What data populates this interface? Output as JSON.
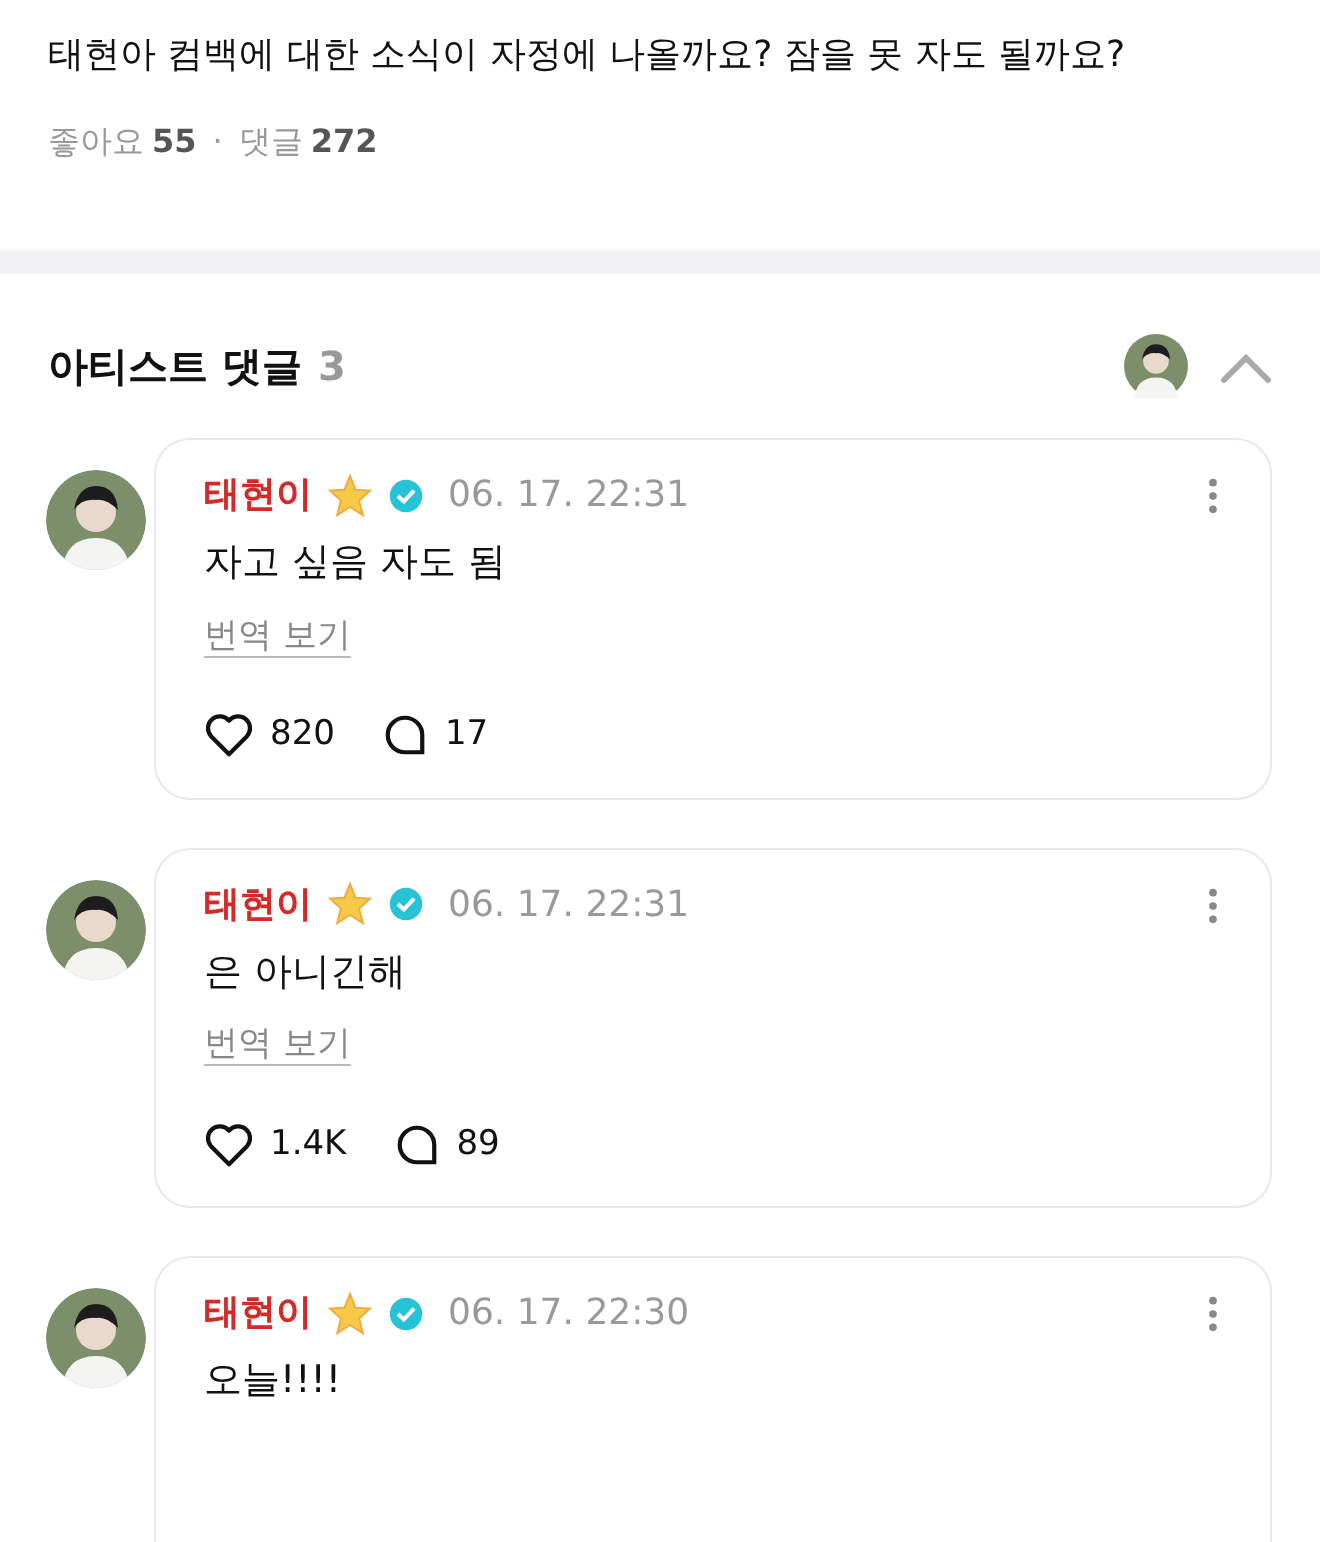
{
  "post": {
    "text": "태현아 컴백에 대한 소식이 자정에 나올까요? 잠을 못 자도 될까요?",
    "like_label": "좋아요",
    "like_count": "55",
    "separator": "·",
    "comment_label": "댓글",
    "comment_count": "272"
  },
  "artist_comments": {
    "title": "아티스트 댓글",
    "count": "3",
    "expanded": true,
    "comments": [
      {
        "author": "태현이",
        "time": "06. 17. 22:31",
        "text": "자고 싶음 자도 됨",
        "translate": "번역 보기",
        "likes": "820",
        "replies": "17"
      },
      {
        "author": "태현이",
        "time": "06. 17. 22:31",
        "text": "은 아니긴해",
        "translate": "번역 보기",
        "likes": "1.4K",
        "replies": "89"
      },
      {
        "author": "태현이",
        "time": "06. 17. 22:30",
        "text": "오늘!!!!"
      }
    ]
  }
}
